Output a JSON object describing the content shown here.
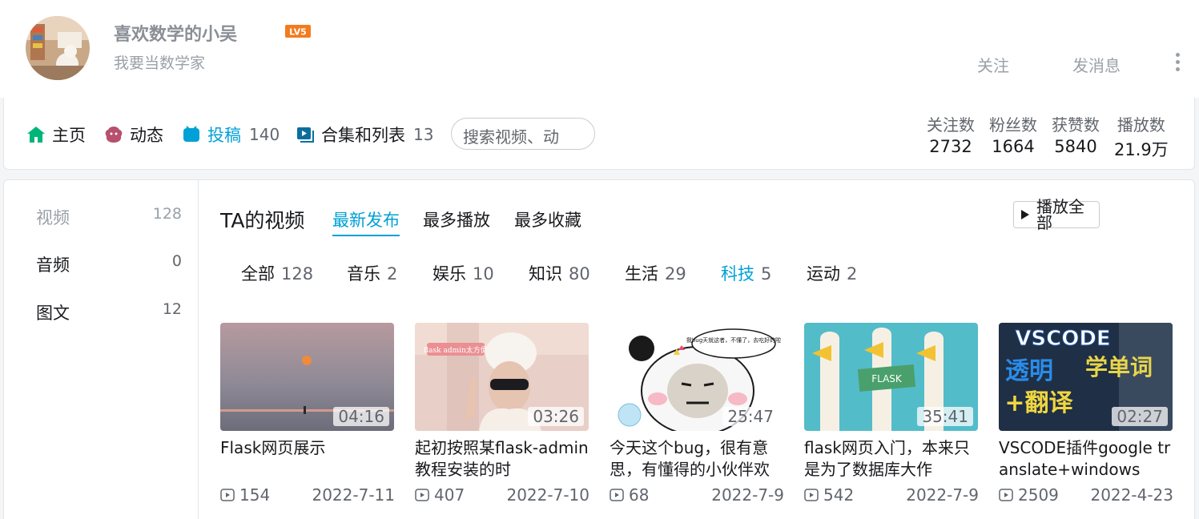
{
  "header": {
    "username": "喜欢数学的小吴",
    "level_badge": "LV5",
    "signature": "我要当数学家",
    "follow_label": "关注",
    "message_label": "发消息"
  },
  "nav": {
    "items": [
      {
        "label": "主页",
        "icon": "home-icon",
        "count": ""
      },
      {
        "label": "动态",
        "icon": "dynamic-icon",
        "count": ""
      },
      {
        "label": "投稿",
        "icon": "upload-icon",
        "count": "140"
      },
      {
        "label": "合集和列表",
        "icon": "collection-icon",
        "count": "13"
      }
    ],
    "search_placeholder": "搜索视频、动",
    "stats": [
      {
        "label": "关注数",
        "value": "2732"
      },
      {
        "label": "粉丝数",
        "value": "1664"
      },
      {
        "label": "获赞数",
        "value": "5840"
      },
      {
        "label": "播放数",
        "value": "21.9万"
      }
    ]
  },
  "sidebar": {
    "items": [
      {
        "label": "视频",
        "count": "128"
      },
      {
        "label": "音频",
        "count": "0"
      },
      {
        "label": "图文",
        "count": "12"
      }
    ]
  },
  "videos_section": {
    "title": "TA的视频",
    "sort_tabs": [
      "最新发布",
      "最多播放",
      "最多收藏"
    ],
    "play_all": "播放全部",
    "categories": [
      {
        "label": "全部",
        "count": "128"
      },
      {
        "label": "音乐",
        "count": "2"
      },
      {
        "label": "娱乐",
        "count": "10"
      },
      {
        "label": "知识",
        "count": "80"
      },
      {
        "label": "生活",
        "count": "29"
      },
      {
        "label": "科技",
        "count": "5"
      },
      {
        "label": "运动",
        "count": "2"
      }
    ]
  },
  "videos": [
    {
      "title": "Flask网页展示",
      "duration": "04:16",
      "plays": "154",
      "date": "2022-7-11"
    },
    {
      "title": "起初按照某flask-admin教程安装的时",
      "duration": "03:26",
      "plays": "407",
      "date": "2022-7-10"
    },
    {
      "title": "今天这个bug，很有意思，有懂得的小伙伴欢",
      "duration": "25:47",
      "plays": "68",
      "date": "2022-7-9"
    },
    {
      "title": "flask网页入门，本来只是为了数据库大作",
      "duration": "35:41",
      "plays": "542",
      "date": "2022-7-9"
    },
    {
      "title": "VSCODE插件google translate+windows",
      "duration": "02:27",
      "plays": "2509",
      "date": "2022-4-23"
    }
  ],
  "thumb_text": {
    "v2_caption": "flask admin太方便",
    "v3_bubble": "我bug天就这者，不懂了，去吃好的啦",
    "v4_sign": "FLASK",
    "v5_line1": "VSCODE",
    "v5_line2": "透明",
    "v5_line3": "学单词",
    "v5_line4": "+翻译"
  },
  "colors": {
    "accent": "#00a1d6",
    "level_badge": "#f37b1d"
  }
}
